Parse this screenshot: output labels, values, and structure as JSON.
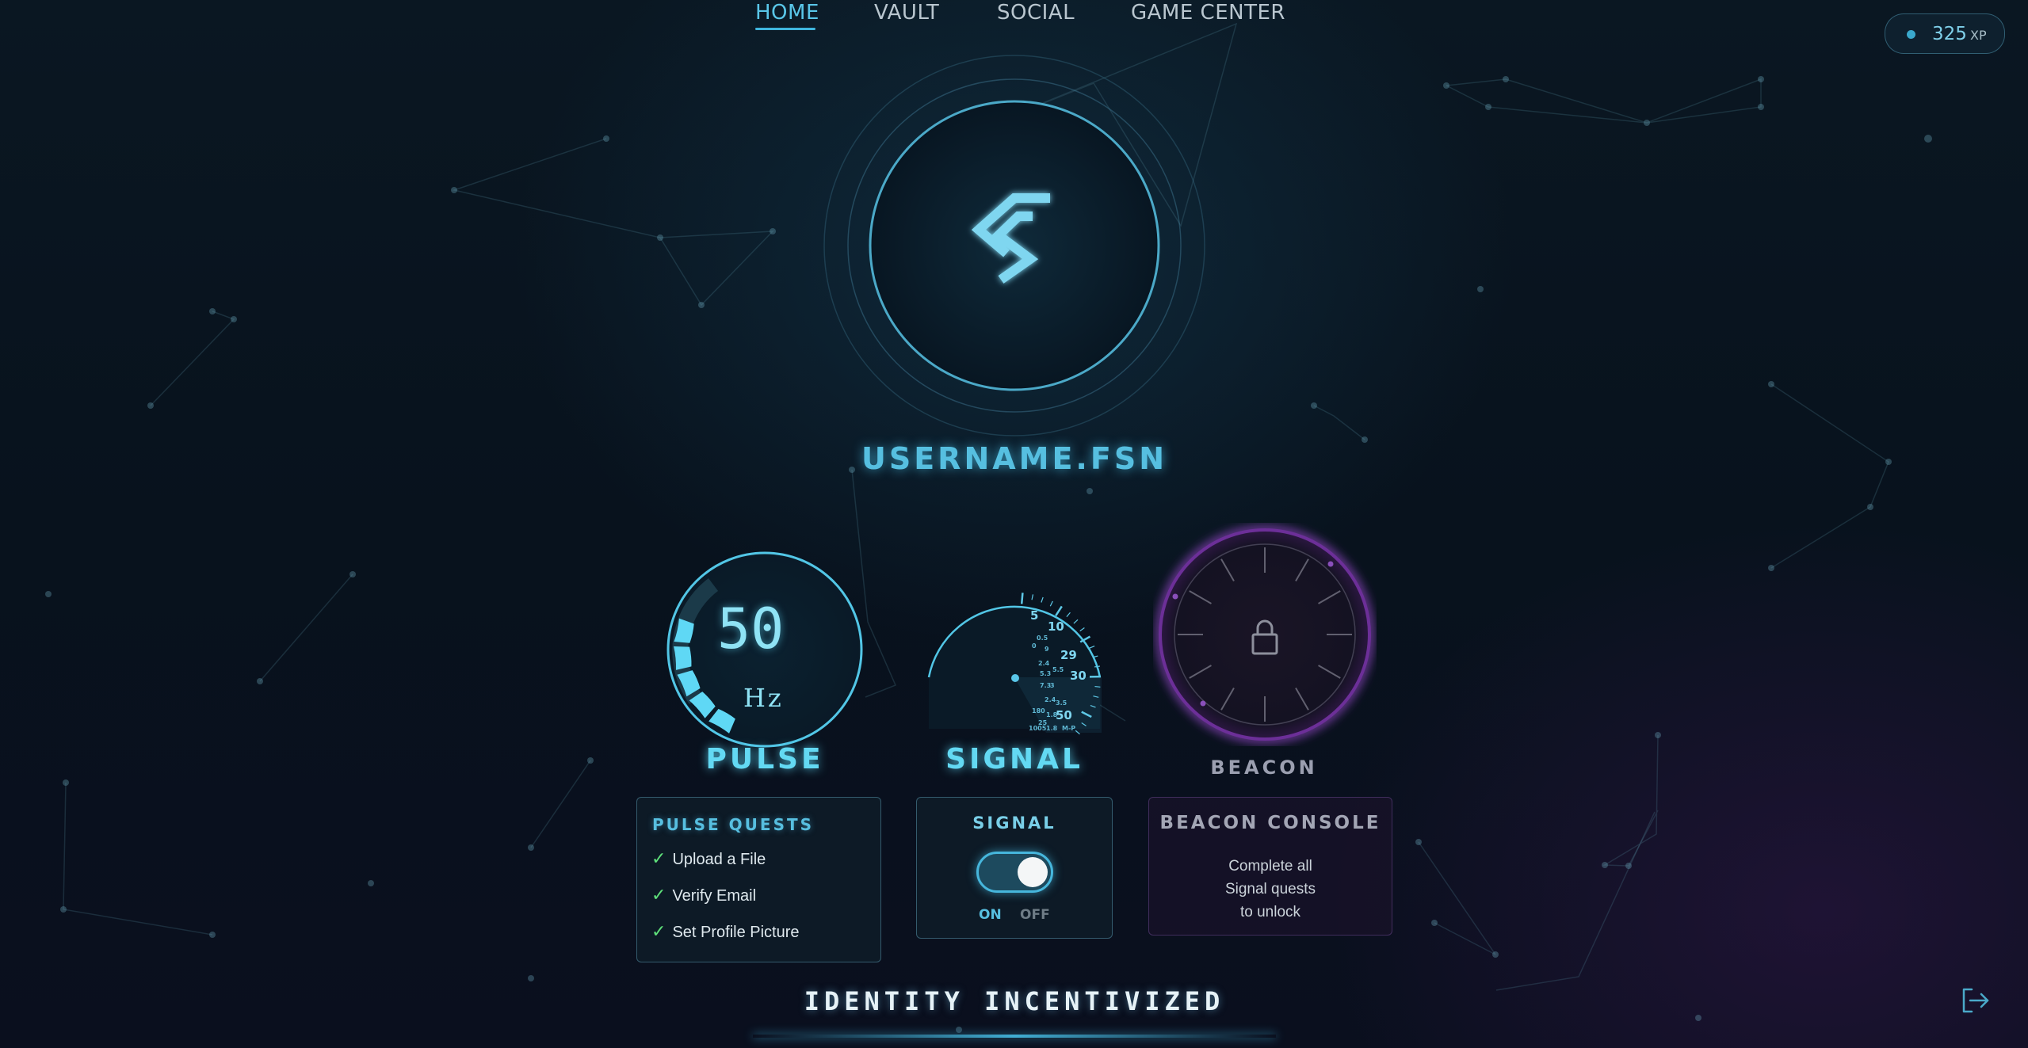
{
  "nav": {
    "items": [
      {
        "label": "HOME",
        "active": true
      },
      {
        "label": "VAULT",
        "active": false
      },
      {
        "label": "SOCIAL",
        "active": false
      },
      {
        "label": "GAME CENTER",
        "active": false
      }
    ]
  },
  "xp": {
    "value": "325",
    "unit": "XP"
  },
  "profile": {
    "username": "USERNAME.FSN",
    "logo_icon": "fsn-logo-icon"
  },
  "gauges": {
    "pulse": {
      "value": "50",
      "unit": "Hz",
      "label": "PULSE",
      "fill_fraction": 0.3
    },
    "signal": {
      "label": "SIGNAL",
      "dial_labels": [
        "5",
        "10",
        "29",
        "30",
        "50"
      ],
      "minor_labels": [
        "0.5",
        "0",
        "9",
        "2.4",
        "5.3",
        "5.5",
        "7.3",
        "3",
        "2.4",
        "3.5",
        "180",
        "1.8",
        "25",
        "1005",
        "1.8",
        "M-P"
      ]
    },
    "beacon": {
      "label": "BEACON",
      "icon": "lock-icon",
      "locked": true
    }
  },
  "panels": {
    "quests": {
      "title": "PULSE QUESTS",
      "items": [
        {
          "label": "Upload a File",
          "done": true
        },
        {
          "label": "Verify Email",
          "done": true
        },
        {
          "label": "Set Profile Picture",
          "done": true
        }
      ],
      "check_glyph": "✓"
    },
    "signal": {
      "title": "SIGNAL",
      "toggle_on": true,
      "on_label": "ON",
      "off_label": "OFF"
    },
    "beacon": {
      "title": "BEACON CONSOLE",
      "line1": "Complete all",
      "line2": "Signal quests",
      "line3": "to unlock"
    }
  },
  "footer": {
    "tagline": "IDENTITY INCENTIVIZED",
    "logout_icon": "logout-icon"
  },
  "colors": {
    "accent": "#4fc3e6",
    "glow": "#63d9f3",
    "beacon": "#7a3ea8",
    "check": "#5ee07a"
  }
}
